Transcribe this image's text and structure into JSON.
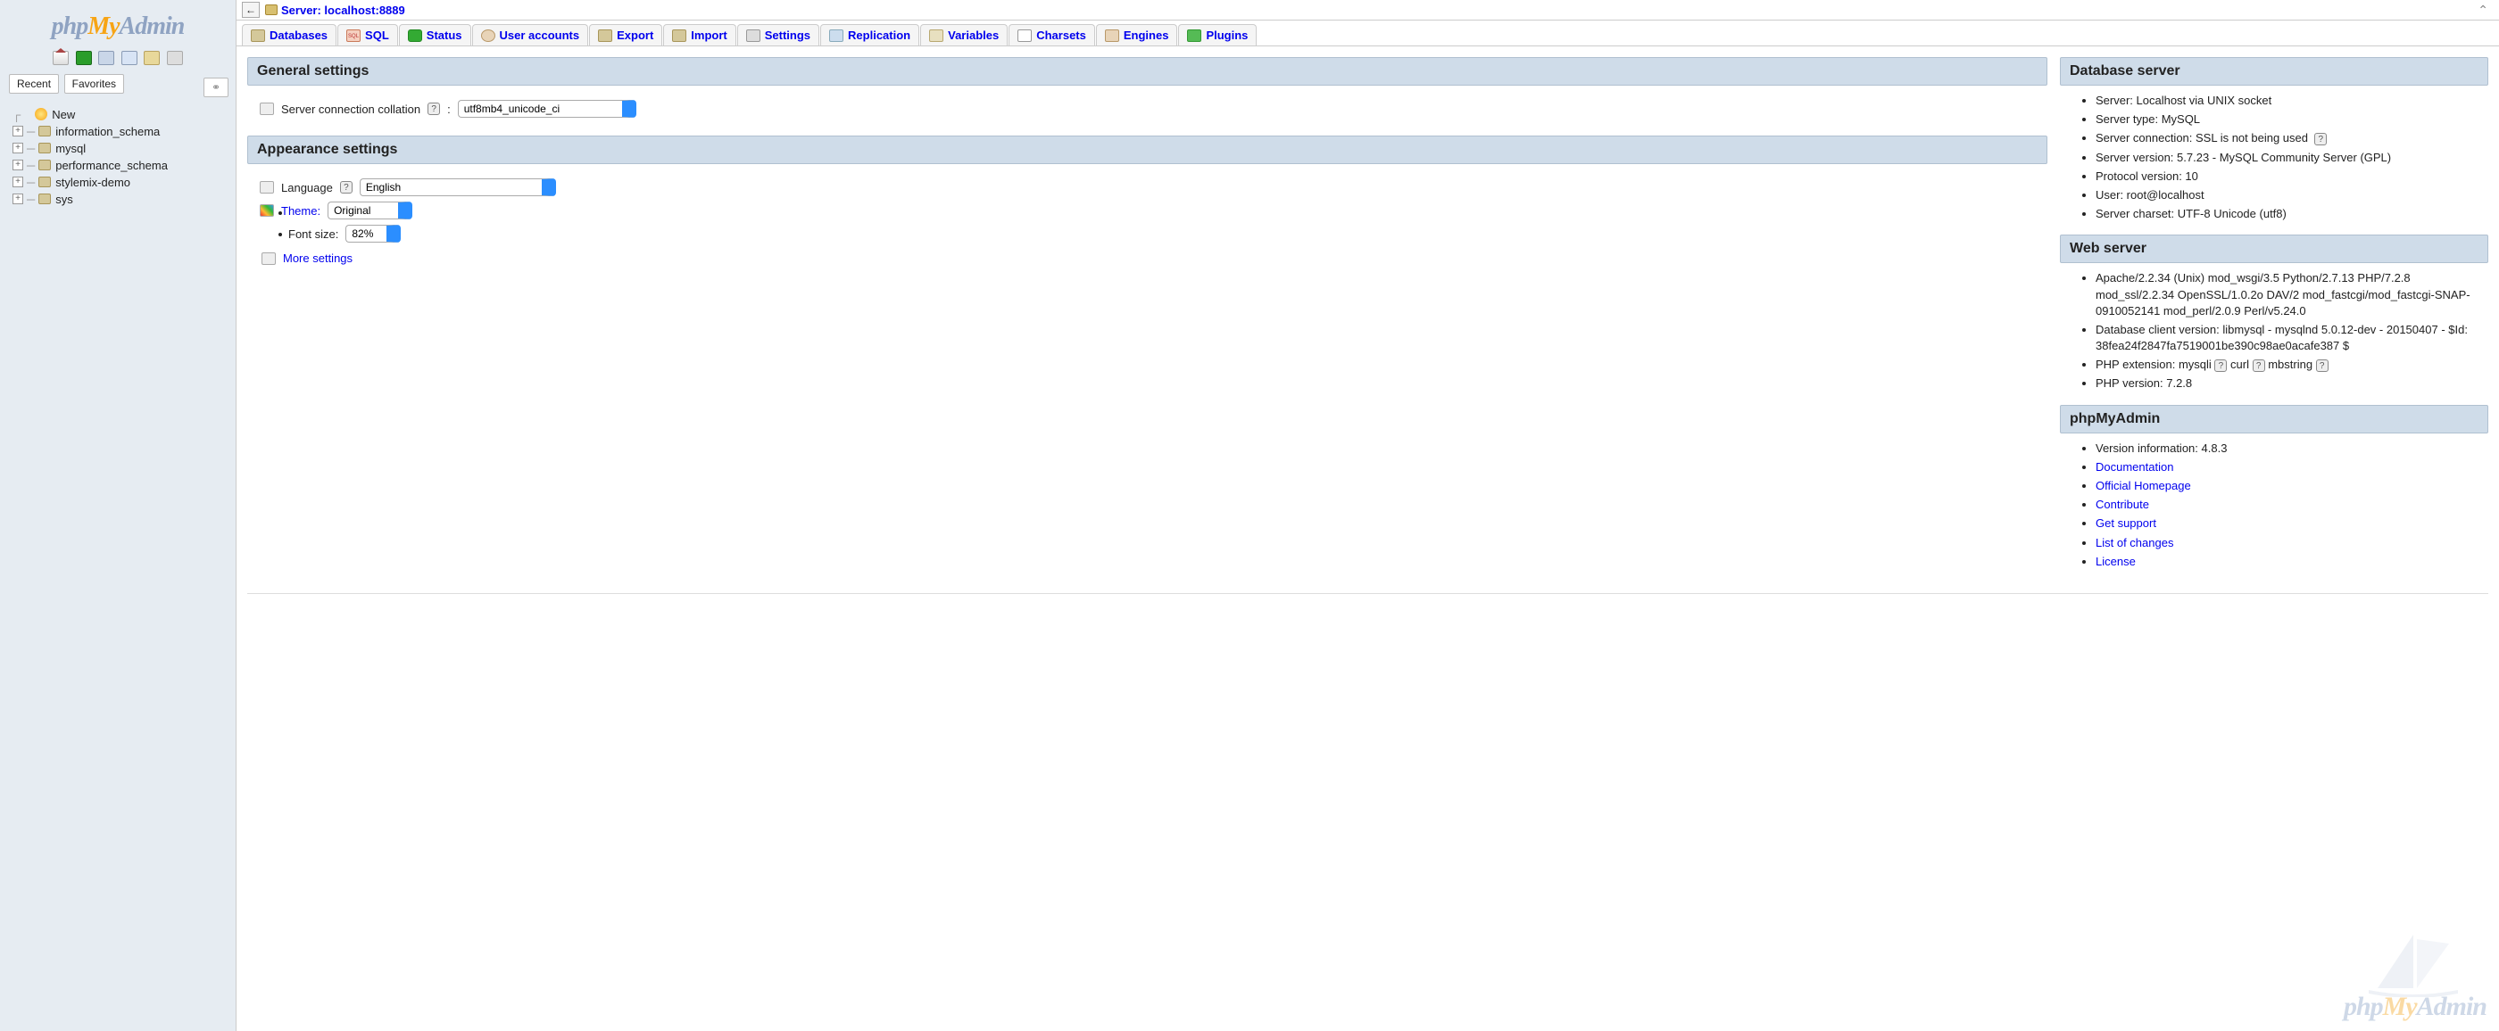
{
  "logo": {
    "p1": "php",
    "p2": "My",
    "p3": "Admin"
  },
  "sidebar": {
    "tabs": {
      "recent": "Recent",
      "favorites": "Favorites"
    },
    "new_label": "New",
    "databases": [
      "information_schema",
      "mysql",
      "performance_schema",
      "stylemix-demo",
      "sys"
    ]
  },
  "breadcrumb": {
    "server_prefix": "Server: ",
    "server": "localhost:8889"
  },
  "tabs": [
    "Databases",
    "SQL",
    "Status",
    "User accounts",
    "Export",
    "Import",
    "Settings",
    "Replication",
    "Variables",
    "Charsets",
    "Engines",
    "Plugins"
  ],
  "general": {
    "heading": "General settings",
    "collation_label": "Server connection collation",
    "collation_value": "utf8mb4_unicode_ci"
  },
  "appearance": {
    "heading": "Appearance settings",
    "language_label": "Language",
    "language_value": "English",
    "theme_label": "Theme:",
    "theme_value": "Original",
    "fontsize_label": "Font size:",
    "fontsize_value": "82%",
    "more_settings": "More settings"
  },
  "db_server": {
    "heading": "Database server",
    "items": [
      "Server: Localhost via UNIX socket",
      "Server type: MySQL",
      "Server connection: SSL is not being used",
      "Server version: 5.7.23 - MySQL Community Server (GPL)",
      "Protocol version: 10",
      "User: root@localhost",
      "Server charset: UTF-8 Unicode (utf8)"
    ],
    "help_on_index": 2
  },
  "web_server": {
    "heading": "Web server",
    "apache": "Apache/2.2.34 (Unix) mod_wsgi/3.5 Python/2.7.13 PHP/7.2.8 mod_ssl/2.2.34 OpenSSL/1.0.2o DAV/2 mod_fastcgi/mod_fastcgi-SNAP-0910052141 mod_perl/2.0.9 Perl/v5.24.0",
    "db_client": "Database client version: libmysql - mysqlnd 5.0.12-dev - 20150407 - $Id: 38fea24f2847fa7519001be390c98ae0acafe387 $",
    "php_ext_label": "PHP extension:",
    "php_ext": [
      "mysqli",
      "curl",
      "mbstring"
    ],
    "php_version": "PHP version: 7.2.8"
  },
  "pma": {
    "heading": "phpMyAdmin",
    "version_label": "Version information: ",
    "version": "4.8.3",
    "links": [
      "Documentation",
      "Official Homepage",
      "Contribute",
      "Get support",
      "List of changes",
      "License"
    ]
  }
}
